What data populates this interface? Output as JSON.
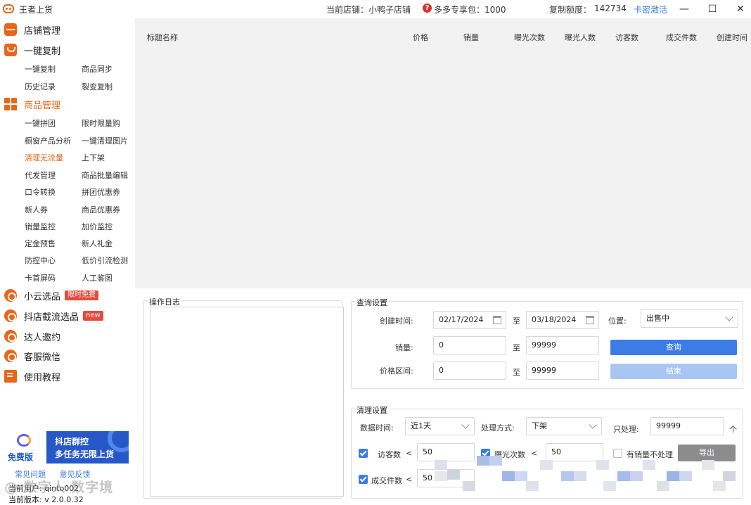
{
  "titlebar": {
    "app_title": "王者上货",
    "store_label": "当前店铺：小鸭子店铺",
    "pack_label": "多多专享包：1000",
    "quota_label": "复制额度：",
    "quota_value": "142734",
    "activate_label": "卡密激活",
    "minimize": "—",
    "maximize": "☐",
    "close": "✕"
  },
  "sidebar": {
    "store_manage": "店铺管理",
    "one_click_copy": "一键复制",
    "copy_subs": [
      "一键复制",
      "商品同步",
      "历史记录",
      "裂变复制"
    ],
    "goods_manage": "商品管理",
    "goods_subs": [
      "一键拼团",
      "限时限量购",
      "橱窗产品分析",
      "一键清理图片",
      "清理无流量",
      "上下架",
      "代发管理",
      "商品批量编辑",
      "口令转换",
      "拼团优惠券",
      "新人券",
      "商品优惠券",
      "销量监控",
      "加价监控",
      "定金预售",
      "新人礼金",
      "防控中心",
      "低价引流检测",
      "卡首屏码",
      "人工鉴图"
    ],
    "xiaoyun": "小云选品",
    "xiaoyun_badge": "限时免费",
    "douyin": "抖店截流选品",
    "douyin_badge": "new",
    "daren": "达人邀约",
    "kefu": "客服微信",
    "tutorial": "使用教程"
  },
  "promo": {
    "free": "免费版",
    "line1": "抖店群控",
    "line2": "多任务无限上货"
  },
  "footer": {
    "faq": "常见问题",
    "feedback": "意见反馈",
    "user": "当前用户: qinto002",
    "version": "当前版本: v 2.0.0.32",
    "watermark": "@ 数字人 数字境"
  },
  "table": {
    "columns": [
      "标题名称",
      "价格",
      "销量",
      "曝光次数",
      "曝光人数",
      "访客数",
      "成交件数",
      "创建时间"
    ]
  },
  "log": {
    "title": "操作日志"
  },
  "query": {
    "title": "查询设置",
    "create_time_label": "创建时间:",
    "start_date": "02/17/2024",
    "to1": "至",
    "end_date": "03/18/2024",
    "position_label": "位置:",
    "position_value": "出售中",
    "sales_label": "销量:",
    "sales_min": "0",
    "to2": "至",
    "sales_max": "99999",
    "query_btn": "查询",
    "price_label": "价格区间:",
    "price_min": "0",
    "to3": "至",
    "price_max": "99999",
    "end_btn": "结束"
  },
  "clean": {
    "title": "清理设置",
    "data_time_label": "数据时间:",
    "data_time_value": "近1天",
    "method_label": "处理方式:",
    "method_value": "下架",
    "only_label": "只处理:",
    "only_value": "99999",
    "unit": "个",
    "visitors_label": "访客数",
    "lt1": "<",
    "visitors_value": "50",
    "exposure_label": "曝光次数",
    "lt2": "<",
    "exposure_value": "50",
    "sold_skip_label": "有销量不处理",
    "export_btn": "导出",
    "orders_label": "成交件数",
    "lt3": "<",
    "orders_value": "50"
  }
}
